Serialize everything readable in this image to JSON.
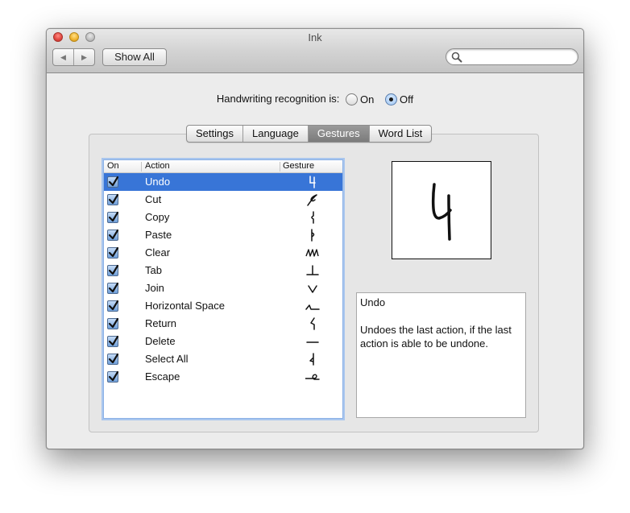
{
  "window": {
    "title": "Ink"
  },
  "toolbar": {
    "back_glyph": "◀",
    "forward_glyph": "▶",
    "show_all_label": "Show All",
    "search_placeholder": "",
    "search_value": ""
  },
  "recognition": {
    "label": "Handwriting recognition is:",
    "options": [
      {
        "label": "On",
        "selected": false
      },
      {
        "label": "Off",
        "selected": true
      }
    ]
  },
  "tabs": [
    {
      "label": "Settings",
      "active": false
    },
    {
      "label": "Language",
      "active": false
    },
    {
      "label": "Gestures",
      "active": true
    },
    {
      "label": "Word List",
      "active": false
    }
  ],
  "table": {
    "headers": {
      "on": "On",
      "action": "Action",
      "gesture": "Gesture"
    },
    "rows": [
      {
        "label": "Undo",
        "checked": true,
        "selected": true,
        "gesture_icon": "undo-gesture-icon"
      },
      {
        "label": "Cut",
        "checked": true,
        "selected": false,
        "gesture_icon": "cut-gesture-icon"
      },
      {
        "label": "Copy",
        "checked": true,
        "selected": false,
        "gesture_icon": "copy-gesture-icon"
      },
      {
        "label": "Paste",
        "checked": true,
        "selected": false,
        "gesture_icon": "paste-gesture-icon"
      },
      {
        "label": "Clear",
        "checked": true,
        "selected": false,
        "gesture_icon": "clear-gesture-icon"
      },
      {
        "label": "Tab",
        "checked": true,
        "selected": false,
        "gesture_icon": "tab-gesture-icon"
      },
      {
        "label": "Join",
        "checked": true,
        "selected": false,
        "gesture_icon": "join-gesture-icon"
      },
      {
        "label": "Horizontal Space",
        "checked": true,
        "selected": false,
        "gesture_icon": "horizontal-space-gesture-icon"
      },
      {
        "label": "Return",
        "checked": true,
        "selected": false,
        "gesture_icon": "return-gesture-icon"
      },
      {
        "label": "Delete",
        "checked": true,
        "selected": false,
        "gesture_icon": "delete-gesture-icon"
      },
      {
        "label": "Select All",
        "checked": true,
        "selected": false,
        "gesture_icon": "select-all-gesture-icon"
      },
      {
        "label": "Escape",
        "checked": true,
        "selected": false,
        "gesture_icon": "escape-gesture-icon"
      }
    ]
  },
  "description": {
    "title": "Undo",
    "text": "Undoes the last action, if the last action is able to be undone."
  },
  "colors": {
    "selection": "#3875d7",
    "focus_ring": "#a9c6ee",
    "active_tab": "#8a8a8a"
  }
}
